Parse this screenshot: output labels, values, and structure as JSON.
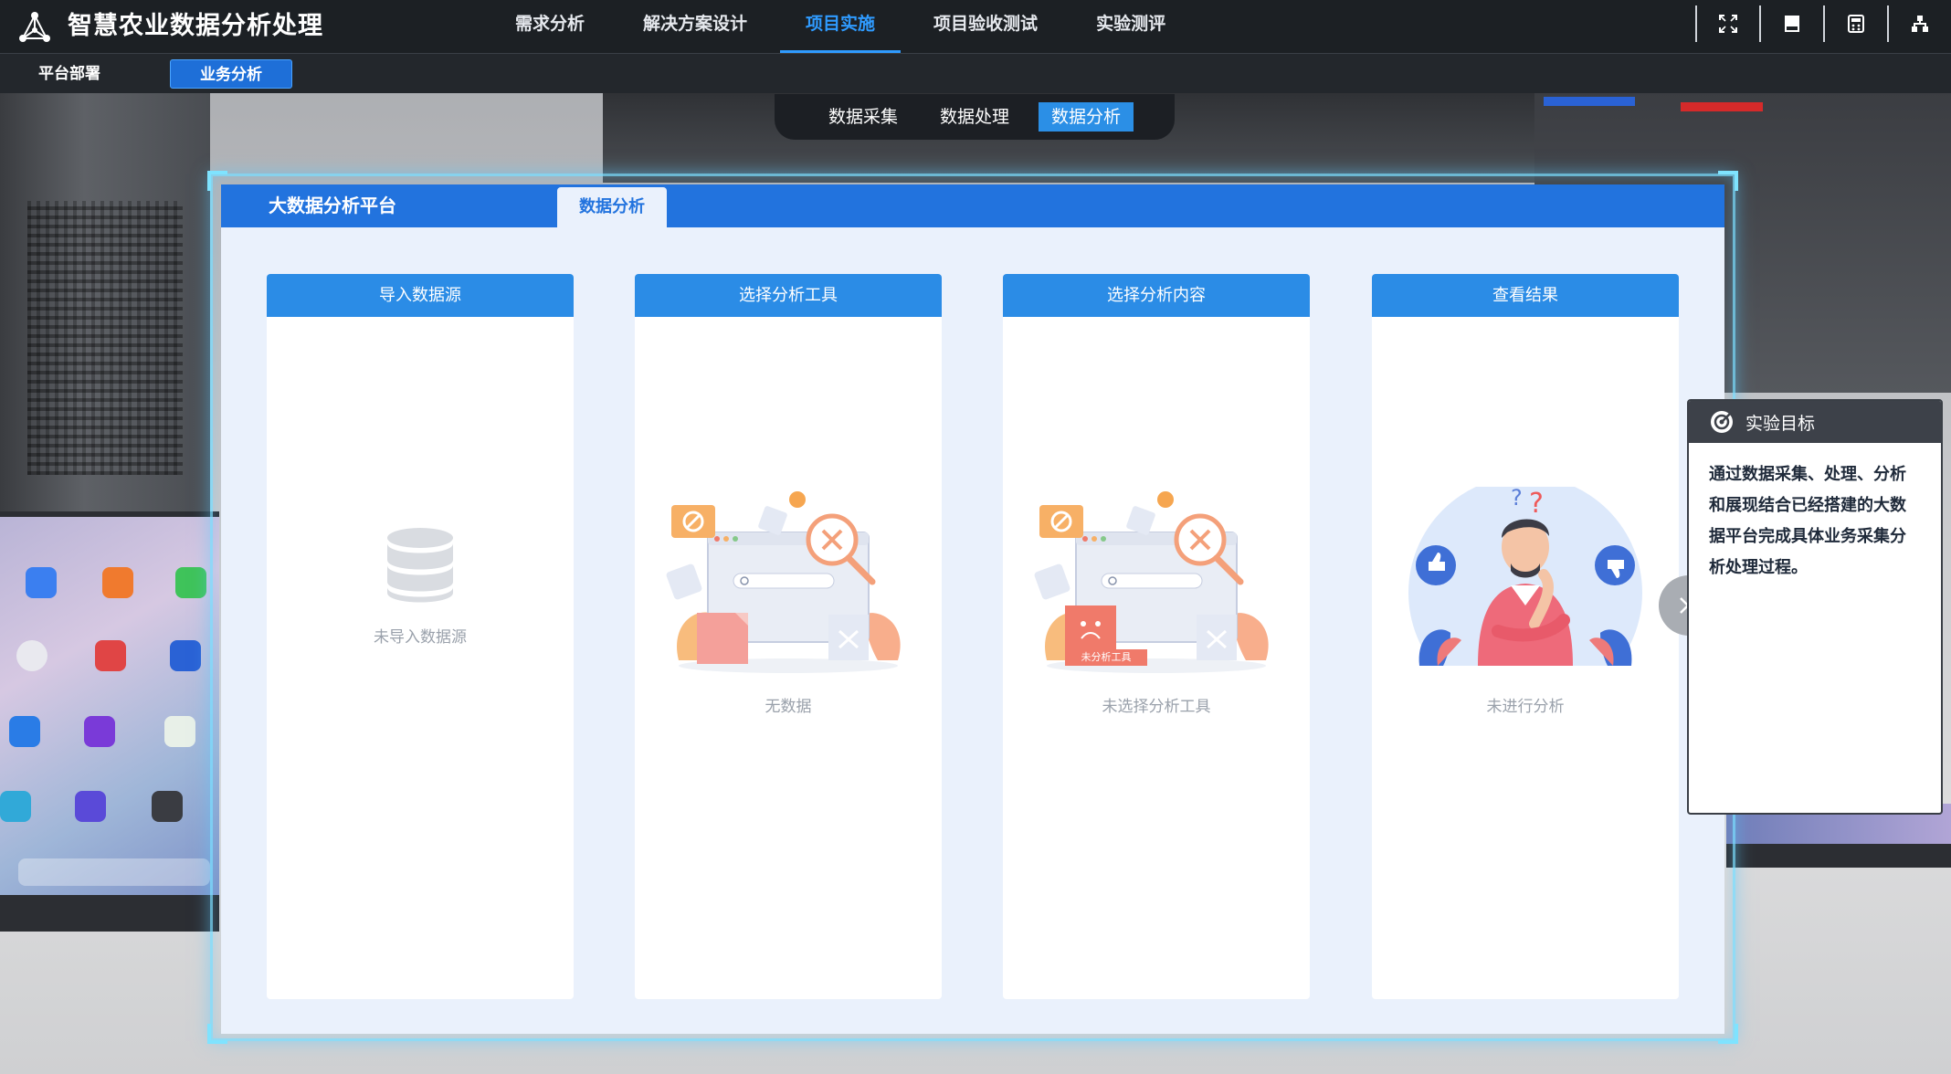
{
  "app": {
    "title": "智慧农业数据分析处理"
  },
  "nav": {
    "items": [
      {
        "label": "需求分析"
      },
      {
        "label": "解决方案设计"
      },
      {
        "label": "项目实施",
        "active": true
      },
      {
        "label": "项目验收测试"
      },
      {
        "label": "实验测评"
      }
    ]
  },
  "toolbar": {
    "icons": [
      "fullscreen-icon",
      "book-icon",
      "calculator-icon",
      "hierarchy-icon"
    ]
  },
  "subnav": {
    "items": [
      {
        "label": "平台部署"
      },
      {
        "label": "业务分析",
        "active": true
      }
    ]
  },
  "stage_tabs": {
    "items": [
      {
        "label": "数据采集"
      },
      {
        "label": "数据处理"
      },
      {
        "label": "数据分析",
        "active": true
      }
    ]
  },
  "panel": {
    "title": "大数据分析平台",
    "tab_label": "数据分析",
    "cards": [
      {
        "title": "导入数据源",
        "caption": "未导入数据源",
        "icon": "database-icon"
      },
      {
        "title": "选择分析工具",
        "caption": "无数据",
        "icon": "no-data-illustration"
      },
      {
        "title": "选择分析内容",
        "caption": "未选择分析工具",
        "icon": "no-tool-illustration",
        "badge": "未分析工具"
      },
      {
        "title": "查看结果",
        "caption": "未进行分析",
        "icon": "thinking-person-illustration"
      }
    ]
  },
  "goal": {
    "title": "实验目标",
    "text": "通过数据采集、处理、分析和展现结合已经搭建的大数据平台完成具体业务采集分析处理过程。"
  },
  "colors": {
    "accent": "#2273de",
    "header_blue": "#2b8ce6",
    "active_nav": "#2f9bff",
    "topbar": "#1c2024"
  }
}
